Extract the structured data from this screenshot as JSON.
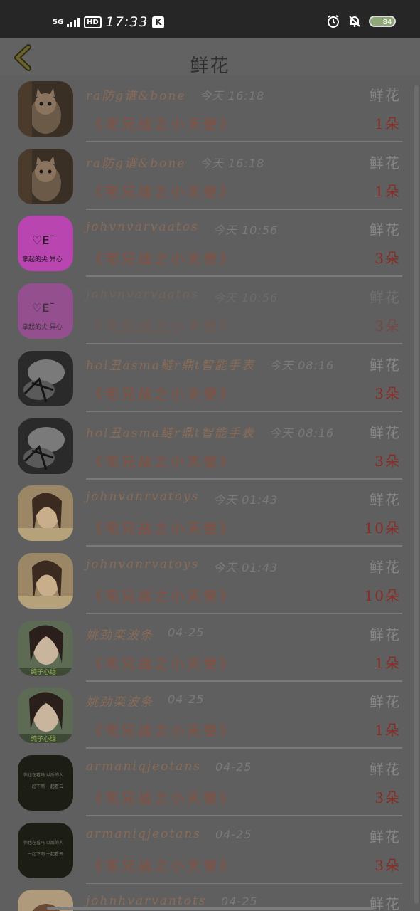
{
  "status_bar": {
    "network": "5G",
    "hd": "HD",
    "time": "17:33",
    "app_badge": "K",
    "battery": "84"
  },
  "header": {
    "title": "鲜花"
  },
  "items": [
    {
      "name": "ra防g谱&bone",
      "time": "今天 16:18",
      "gift": "鲜花",
      "product": "《宅兄战之小天使》",
      "count": "1朵",
      "avatar": "cat",
      "faded": false
    },
    {
      "name": "ra防g谱&bone",
      "time": "今天 16:18",
      "gift": "鲜花",
      "product": "《宅兄战之小天使》",
      "count": "1朵",
      "avatar": "cat",
      "faded": false
    },
    {
      "name": "johvnvarvaatos",
      "time": "今天 10:56",
      "gift": "鲜花",
      "product": "《宅兄战之小天使》",
      "count": "3朵",
      "avatar": "pink",
      "faded": false
    },
    {
      "name": "johvnvarvaatos",
      "time": "今天 10:56",
      "gift": "鲜花",
      "product": "《宅兄战之小天使》",
      "count": "3朵",
      "avatar": "pink",
      "faded": true
    },
    {
      "name": "hol丑asma鲢r鼎t智能手表",
      "time": "今天 08:16",
      "gift": "鲜花",
      "product": "《宅兄战之小天使》",
      "count": "3朵",
      "avatar": "bw",
      "faded": false
    },
    {
      "name": "hol丑asma鲢r鼎t智能手表",
      "time": "今天 08:16",
      "gift": "鲜花",
      "product": "《宅兄战之小天使》",
      "count": "3朵",
      "avatar": "bw",
      "faded": false
    },
    {
      "name": "johnvanrvatoys",
      "time": "今天 01:43",
      "gift": "鲜花",
      "product": "《宅兄战之小天使》",
      "count": "10朵",
      "avatar": "girl1",
      "faded": false
    },
    {
      "name": "johnvanrvatoys",
      "time": "今天 01:43",
      "gift": "鲜花",
      "product": "《宅兄战之小天使》",
      "count": "10朵",
      "avatar": "girl1",
      "faded": false
    },
    {
      "name": "姚劲栾波条",
      "time": "04-25",
      "gift": "鲜花",
      "product": "《宅兄战之小天使》",
      "count": "1朵",
      "avatar": "girl2",
      "faded": false
    },
    {
      "name": "姚劲栾波条",
      "time": "04-25",
      "gift": "鲜花",
      "product": "《宅兄战之小天使》",
      "count": "1朵",
      "avatar": "girl2",
      "faded": false
    },
    {
      "name": "armaniqjeotans",
      "time": "04-25",
      "gift": "鲜花",
      "product": "《宅兄战之小天使》",
      "count": "3朵",
      "avatar": "dark",
      "faded": false
    },
    {
      "name": "armaniqjeotans",
      "time": "04-25",
      "gift": "鲜花",
      "product": "《宅兄战之小天使》",
      "count": "3朵",
      "avatar": "dark",
      "faded": false
    },
    {
      "name": "johnhvarvantots",
      "time": "04-25",
      "gift": "鲜花",
      "product": "",
      "count": "",
      "avatar": "girl3",
      "faded": false
    }
  ]
}
